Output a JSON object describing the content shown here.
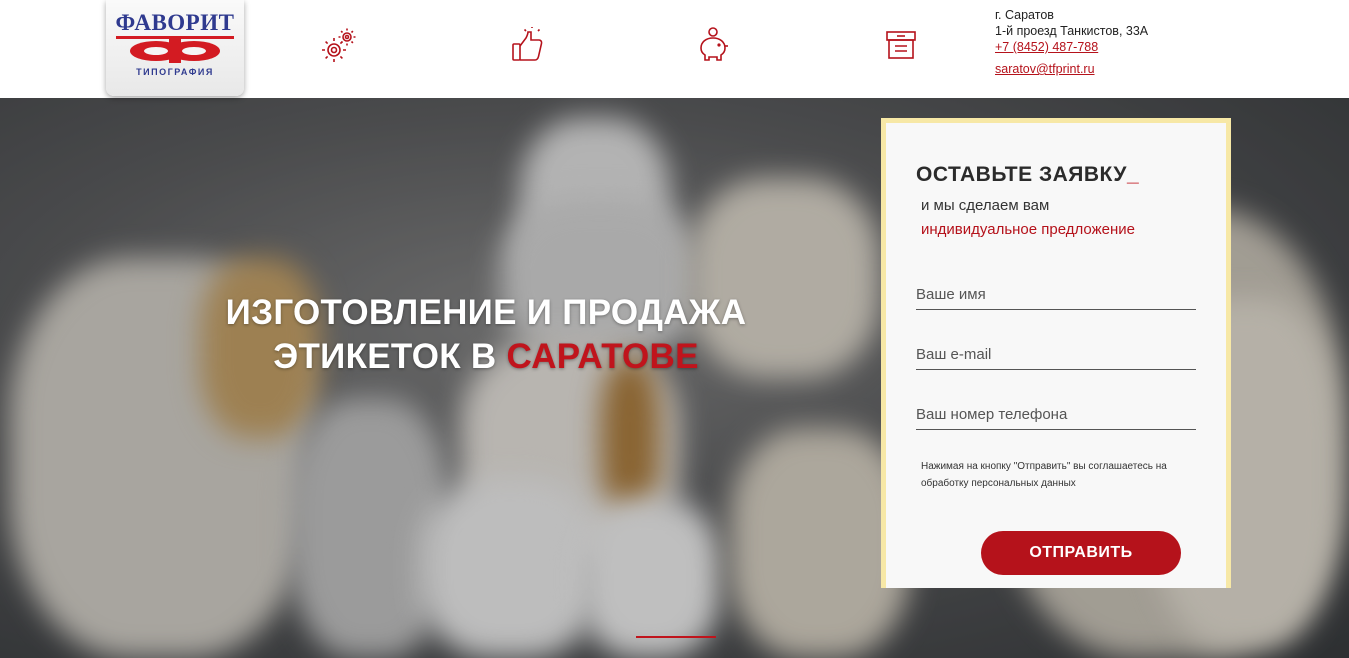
{
  "header": {
    "logo": {
      "title": "ФАВОРИТ",
      "subtitle": "ТИПОГРАФИЯ"
    },
    "icons": [
      "gear-icon",
      "thumbs-up-icon",
      "piggy-bank-icon",
      "archive-box-icon"
    ],
    "contacts": {
      "city": "г. Саратов",
      "address": "1-й проезд Танкистов, 33А",
      "phone": "+7 (8452) 487-788",
      "email": "saratov@tfprint.ru"
    }
  },
  "hero": {
    "title_line1": "ИЗГОТОВЛЕНИЕ И ПРОДАЖА",
    "title_line2_prefix": "ЭТИКЕТОК В ",
    "title_line2_accent": "САРАТОВЕ"
  },
  "form": {
    "title": "ОСТАВЬТЕ ЗАЯВКУ",
    "title_cursor": "_",
    "subtitle": "и мы сделаем вам",
    "subtitle_accent": "индивидуальное предложение",
    "name_placeholder": "Ваше имя",
    "email_placeholder": "Ваш e-mail",
    "phone_placeholder": "Ваш номер телефона",
    "consent": "Нажимая на кнопку \"Отправить\" вы соглашаетесь на обработку персональных данных",
    "submit_label": "ОТПРАВИТЬ"
  },
  "colors": {
    "accent": "#b5121b",
    "logo_blue": "#2f3a8f",
    "card_border": "#f7e8a6"
  }
}
